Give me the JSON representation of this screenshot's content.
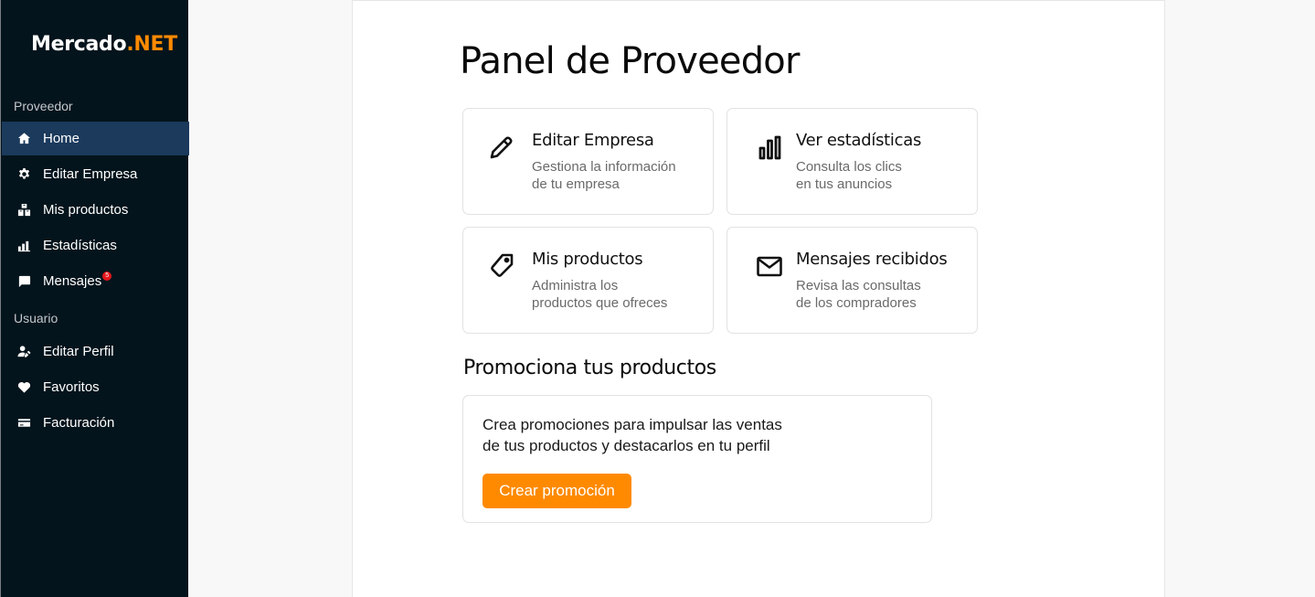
{
  "brand": {
    "name_main": "Mercado",
    "name_accent": ".NET",
    "accent_color": "#ff8a00"
  },
  "sidebar": {
    "sections": [
      {
        "label": "Proveedor"
      },
      {
        "label": "Usuario"
      }
    ],
    "items": [
      {
        "label": "Home",
        "icon": "home-icon",
        "active": true
      },
      {
        "label": "Editar Empresa",
        "icon": "gear-icon"
      },
      {
        "label": "Mis productos",
        "icon": "boxes-icon"
      },
      {
        "label": "Estadísticas",
        "icon": "bar-chart-icon"
      },
      {
        "label": "Mensajes",
        "icon": "message-icon",
        "badge": "5"
      },
      {
        "label": "Editar Perfil",
        "icon": "user-edit-icon"
      },
      {
        "label": "Favoritos",
        "icon": "heart-icon"
      },
      {
        "label": "Facturación",
        "icon": "credit-card-icon"
      }
    ],
    "background": "#04141c",
    "active_color": "#1b3a5c"
  },
  "main": {
    "title": "Panel de Proveedor",
    "cards": [
      {
        "title": "Editar Empresa",
        "desc_line1": "Gestiona la información",
        "desc_line2": "de tu empresa",
        "icon": "pencil-icon"
      },
      {
        "title": "Ver estadísticas",
        "desc_line1": "Consulta los clics",
        "desc_line2": "en tus anuncios",
        "icon": "bar-chart-icon"
      },
      {
        "title": "Mis productos",
        "desc_line1": "Administra los",
        "desc_line2": "productos que ofreces",
        "icon": "tag-icon"
      },
      {
        "title": "Mensajes recibidos",
        "desc_line1": "Revisa las consultas",
        "desc_line2": "de los compradores",
        "icon": "mail-icon"
      }
    ],
    "promo": {
      "title": "Promociona tus productos",
      "text_line1": "Crea promociones para impulsar las ventas",
      "text_line2": "de tus productos y destacarlos en tu perfil",
      "button_label": "Crear promoción"
    }
  }
}
